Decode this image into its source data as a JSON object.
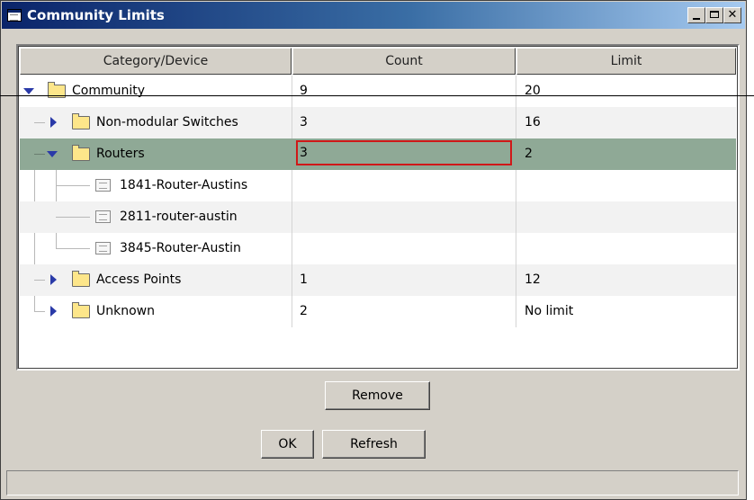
{
  "window": {
    "title": "Community Limits"
  },
  "columns": {
    "category": "Category/Device",
    "count": "Count",
    "limit": "Limit"
  },
  "rows": [
    {
      "label": "Community",
      "count": "9",
      "limit": "20"
    },
    {
      "label": "Non-modular Switches",
      "count": "3",
      "limit": "16"
    },
    {
      "label": "Routers",
      "count": "3",
      "limit": "2"
    },
    {
      "label": "1841-Router-Austins",
      "count": "",
      "limit": ""
    },
    {
      "label": "2811-router-austin",
      "count": "",
      "limit": ""
    },
    {
      "label": "3845-Router-Austin",
      "count": "",
      "limit": ""
    },
    {
      "label": "Access Points",
      "count": "1",
      "limit": "12"
    },
    {
      "label": "Unknown",
      "count": "2",
      "limit": "No limit"
    }
  ],
  "buttons": {
    "remove": "Remove",
    "ok": "OK",
    "refresh": "Refresh"
  },
  "colors": {
    "selected_row": "#8fa996",
    "edit_border": "#d01818",
    "title_start": "#0a246a",
    "title_end": "#a6caf0"
  },
  "icons": {
    "expanded": "triangle-down-icon",
    "collapsed": "triangle-right-icon",
    "folder": "folder-icon",
    "device": "device-icon"
  }
}
